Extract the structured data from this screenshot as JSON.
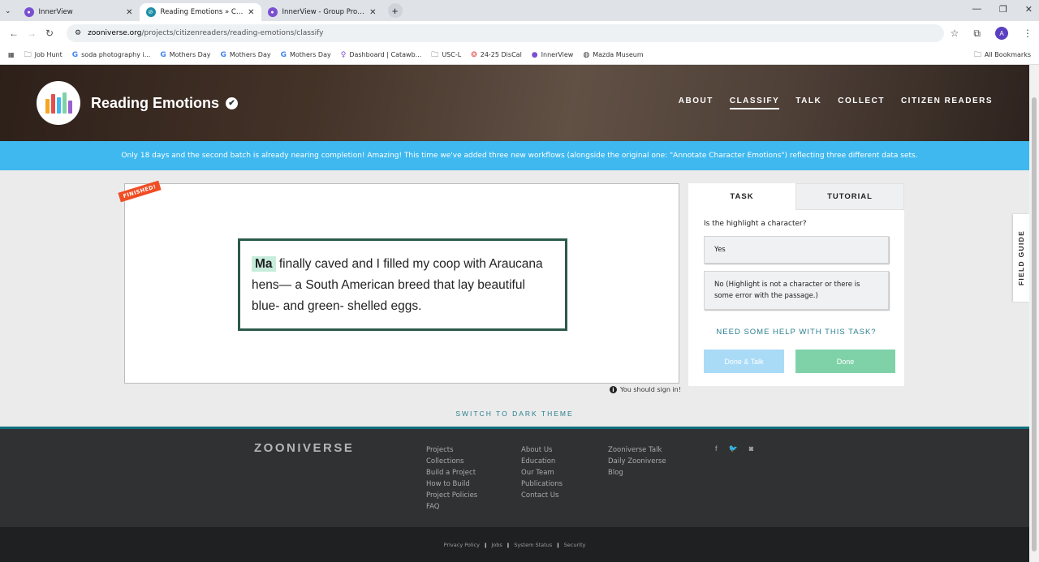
{
  "browser": {
    "tabs": [
      {
        "title": "InnerView",
        "active": false,
        "favicon_color": "#7a4fd0"
      },
      {
        "title": "Reading Emotions » Classify —",
        "active": true,
        "favicon_color": "#1e8fa6"
      },
      {
        "title": "InnerView - Group Profile - Beta",
        "active": false,
        "favicon_color": "#7a4fd0"
      }
    ],
    "url_domain": "zooniverse.org",
    "url_path": "/projects/citizenreaders/reading-emotions/classify",
    "profile_initial": "A",
    "bookmarks": [
      {
        "label": "Job Hunt",
        "icon": "folder-icon"
      },
      {
        "label": "soda photography i...",
        "icon": "google-icon"
      },
      {
        "label": "Mothers Day",
        "icon": "google-icon"
      },
      {
        "label": "Mothers Day",
        "icon": "google-icon"
      },
      {
        "label": "Mothers Day",
        "icon": "google-icon"
      },
      {
        "label": "Dashboard | Catawb...",
        "icon": "pin-icon"
      },
      {
        "label": "USC-L",
        "icon": "folder-icon"
      },
      {
        "label": "24-25 DisCal",
        "icon": "calendar-icon"
      },
      {
        "label": "InnerView",
        "icon": "innerview-icon"
      },
      {
        "label": "Mazda Museum",
        "icon": "globe-icon"
      }
    ],
    "all_bookmarks": "All Bookmarks"
  },
  "project": {
    "title": "Reading Emotions",
    "nav": [
      "ABOUT",
      "CLASSIFY",
      "TALK",
      "COLLECT",
      "CITIZEN READERS"
    ],
    "active_nav": "CLASSIFY",
    "announcement": "Only 18 days and the second batch is already nearing completion! Amazing! This time we've added three new workflows (alongside the original one: \"Annotate Character Emotions\") reflecting three different data sets."
  },
  "subject": {
    "badge": "FINISHED!",
    "highlight": "Ma",
    "text": " finally caved and I filled my coop with Araucana hens— a South American breed that lay beautiful blue- and green- shelled eggs.",
    "signin": "You should sign in!"
  },
  "task": {
    "tab_task": "TASK",
    "tab_tutorial": "TUTORIAL",
    "question": "Is the highlight a character?",
    "answers": [
      "Yes",
      "No (Highlight is not a character or there is some error with the passage.)"
    ],
    "help": "NEED SOME HELP WITH THIS TASK?",
    "done_talk": "Done & Talk",
    "done": "Done"
  },
  "field_guide": "FIELD GUIDE",
  "switch_theme": "SWITCH TO DARK THEME",
  "footer": {
    "logo": "ZOONIVERSE",
    "col1": [
      "Projects",
      "Collections",
      "Build a Project",
      "How to Build",
      "Project Policies",
      "FAQ"
    ],
    "col2": [
      "About Us",
      "Education",
      "Our Team",
      "Publications",
      "Contact Us"
    ],
    "col3": [
      "Zooniverse Talk",
      "Daily Zooniverse",
      "Blog"
    ],
    "bottom": [
      "Privacy Policy",
      "Jobs",
      "System Status",
      "Security"
    ]
  }
}
